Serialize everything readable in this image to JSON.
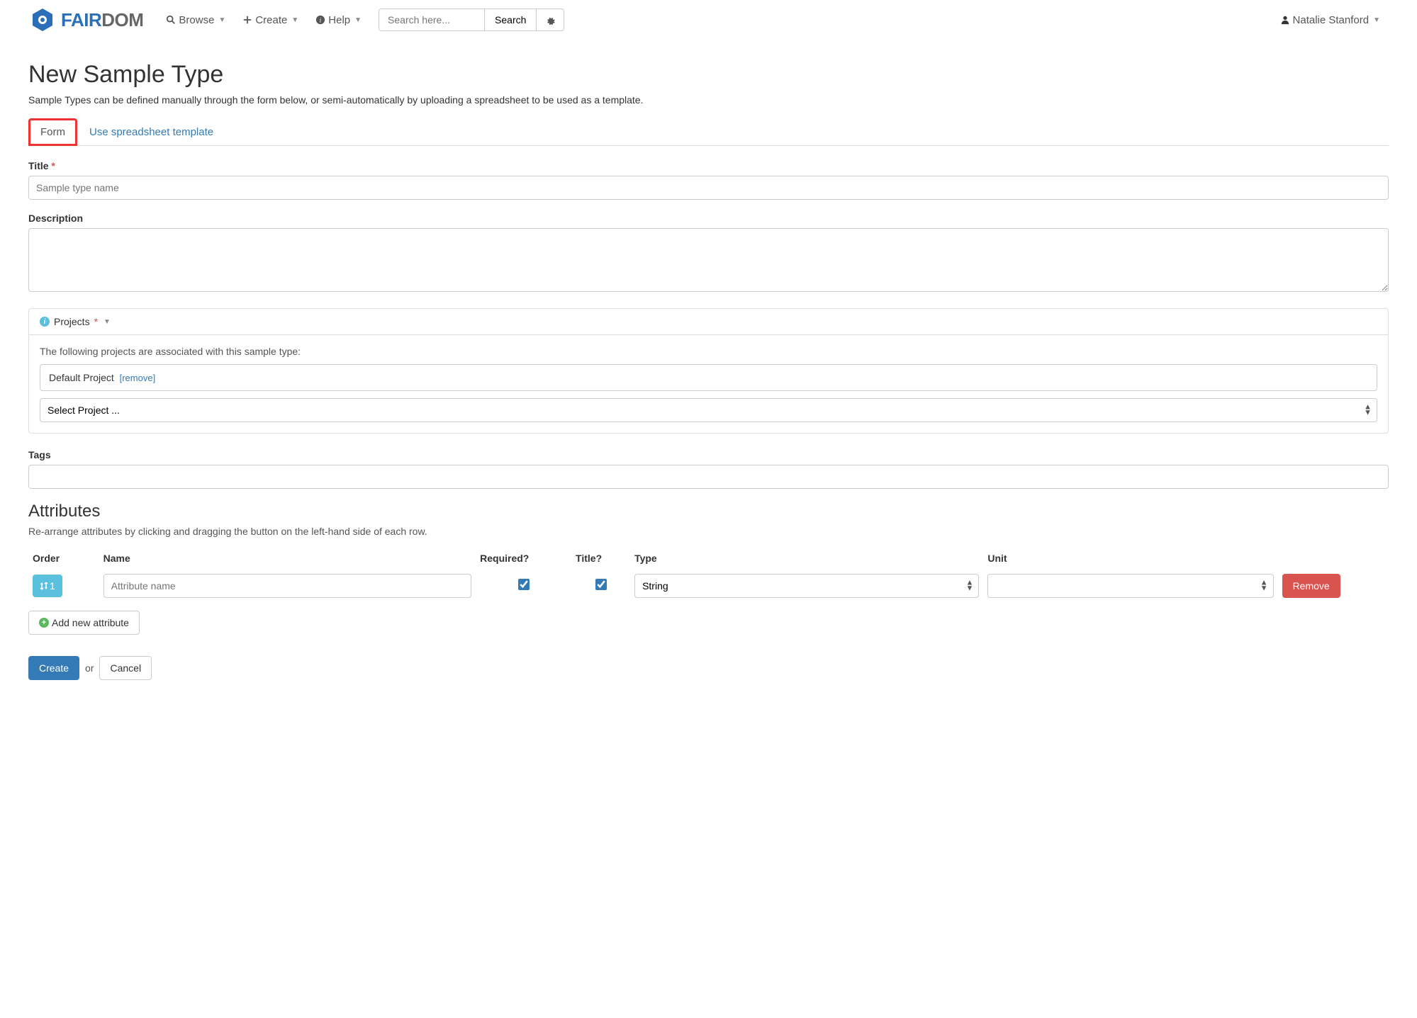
{
  "nav": {
    "browse": "Browse",
    "create": "Create",
    "help": "Help",
    "search_placeholder": "Search here...",
    "search_button": "Search",
    "user": "Natalie Stanford"
  },
  "logo": {
    "fair": "FAIR",
    "dom": "DOM"
  },
  "page": {
    "title": "New Sample Type",
    "subtitle": "Sample Types can be defined manually through the form below, or semi-automatically by uploading a spreadsheet to be used as a template."
  },
  "tabs": {
    "form": "Form",
    "spreadsheet": "Use spreadsheet template"
  },
  "form": {
    "title_label": "Title",
    "title_placeholder": "Sample type name",
    "description_label": "Description",
    "projects_label": "Projects",
    "projects_assoc": "The following projects are associated with this sample type:",
    "default_project": "Default Project",
    "remove": "[remove]",
    "select_project": "Select Project ...",
    "tags_label": "Tags"
  },
  "attributes": {
    "heading": "Attributes",
    "desc": "Re-arrange attributes by clicking and dragging the button on the left-hand side of each row.",
    "cols": {
      "order": "Order",
      "name": "Name",
      "required": "Required?",
      "title": "Title?",
      "type": "Type",
      "unit": "Unit"
    },
    "row": {
      "order": "1",
      "name_placeholder": "Attribute name",
      "required": true,
      "title": true,
      "type": "String",
      "unit": ""
    },
    "remove_btn": "Remove",
    "add_btn": "Add new attribute"
  },
  "actions": {
    "create": "Create",
    "or": "or",
    "cancel": "Cancel"
  }
}
